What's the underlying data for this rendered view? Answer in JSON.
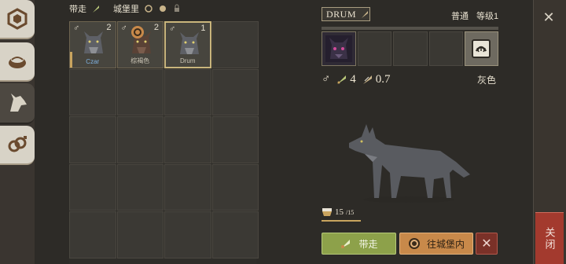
{
  "nav": {
    "tabs": [
      {
        "icon": "castle-hex-icon",
        "active": false
      },
      {
        "icon": "bowl-icon",
        "active": false
      },
      {
        "icon": "wolf-head-icon",
        "active": true
      },
      {
        "icon": "breeding-icon",
        "active": false
      }
    ]
  },
  "topbar": {
    "carry_label": "带走",
    "castle_label": "城堡里"
  },
  "grid": {
    "cells": [
      {
        "sex": "♂",
        "level": "2",
        "name": "Czar",
        "name_color": "blue",
        "selected": false
      },
      {
        "sex": "♂",
        "level": "2",
        "name": "棕褐色",
        "name_color": "gray",
        "selected": false
      },
      {
        "sex": "♂",
        "level": "1",
        "name": "Drum",
        "name_color": "gray",
        "selected": true
      }
    ]
  },
  "detail": {
    "name": "DRUM",
    "rarity": "普通",
    "level": "等级1",
    "sex": "♂",
    "attack": "4",
    "speed": "0.7",
    "color": "灰色",
    "hp_current": "15",
    "hp_max": "/15"
  },
  "actions": {
    "take": "带走",
    "to_castle": "往城堡内",
    "delete": "✕"
  },
  "window": {
    "close_label": "关闭",
    "close_x": "✕"
  }
}
